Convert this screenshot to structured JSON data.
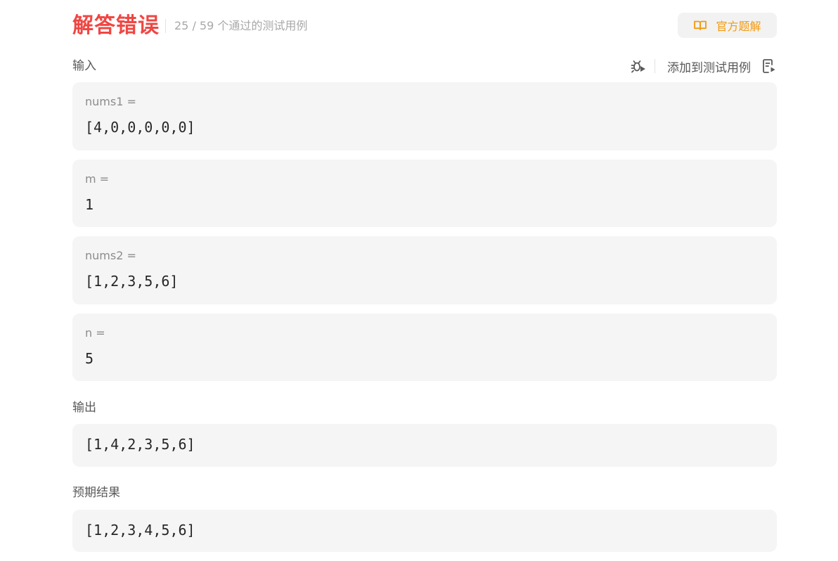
{
  "header": {
    "result_title": "解答错误",
    "pass_count": "25 / 59 个通过的测试用例",
    "solution_button_label": "官方题解"
  },
  "colors": {
    "error_red": "#ef4743",
    "accent_orange": "#f29a0f",
    "box_background": "#f5f5f5"
  },
  "input": {
    "label": "输入",
    "add_testcase_label": "添加到测试用例",
    "debug_icon": "debug-icon",
    "add_icon": "add-testcase-icon",
    "vars": [
      {
        "name": "nums1 =",
        "value": "[4,0,0,0,0,0]"
      },
      {
        "name": "m =",
        "value": "1"
      },
      {
        "name": "nums2 =",
        "value": "[1,2,3,5,6]"
      },
      {
        "name": "n =",
        "value": "5"
      }
    ]
  },
  "output": {
    "label": "输出",
    "value": "[1,4,2,3,5,6]"
  },
  "expected": {
    "label": "预期结果",
    "value": "[1,2,3,4,5,6]"
  }
}
